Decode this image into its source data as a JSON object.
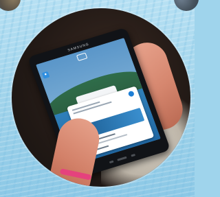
{
  "tablet": {
    "brand_text": "SAMSUNG"
  }
}
